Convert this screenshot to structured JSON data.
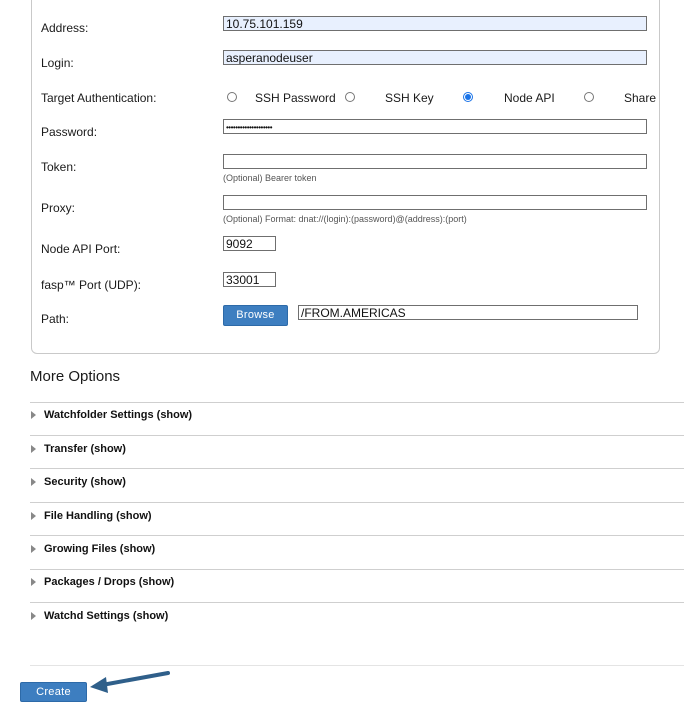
{
  "form": {
    "address_label": "Address:",
    "address_value": "10.75.101.159",
    "login_label": "Login:",
    "login_value": "asperanodeuser",
    "target_auth_label": "Target Authentication:",
    "auth_options": [
      "SSH Password",
      "SSH Key",
      "Node API",
      "Share"
    ],
    "auth_selected": "Node API",
    "password_label": "Password:",
    "password_value": "••••••••••••••••••••",
    "token_label": "Token:",
    "token_hint": "(Optional) Bearer token",
    "proxy_label": "Proxy:",
    "proxy_hint": "(Optional) Format: dnat://(login):(password)@(address):(port)",
    "node_api_port_label": "Node API Port:",
    "node_api_port_value": "9092",
    "fasp_port_label": "fasp™ Port (UDP):",
    "fasp_port_value": "33001",
    "path_label": "Path:",
    "browse_label": "Browse",
    "path_value": "/FROM.AMERICAS"
  },
  "more_options": {
    "title": "More Options",
    "sections": [
      "Watchfolder Settings (show)",
      "Transfer (show)",
      "Security (show)",
      "File Handling (show)",
      "Growing Files (show)",
      "Packages / Drops (show)",
      "Watchd Settings (show)"
    ]
  },
  "create_label": "Create",
  "colors": {
    "accent": "#3d7ec0",
    "arrow": "#2f5f8a",
    "radio_selected": "#1a73e8"
  }
}
